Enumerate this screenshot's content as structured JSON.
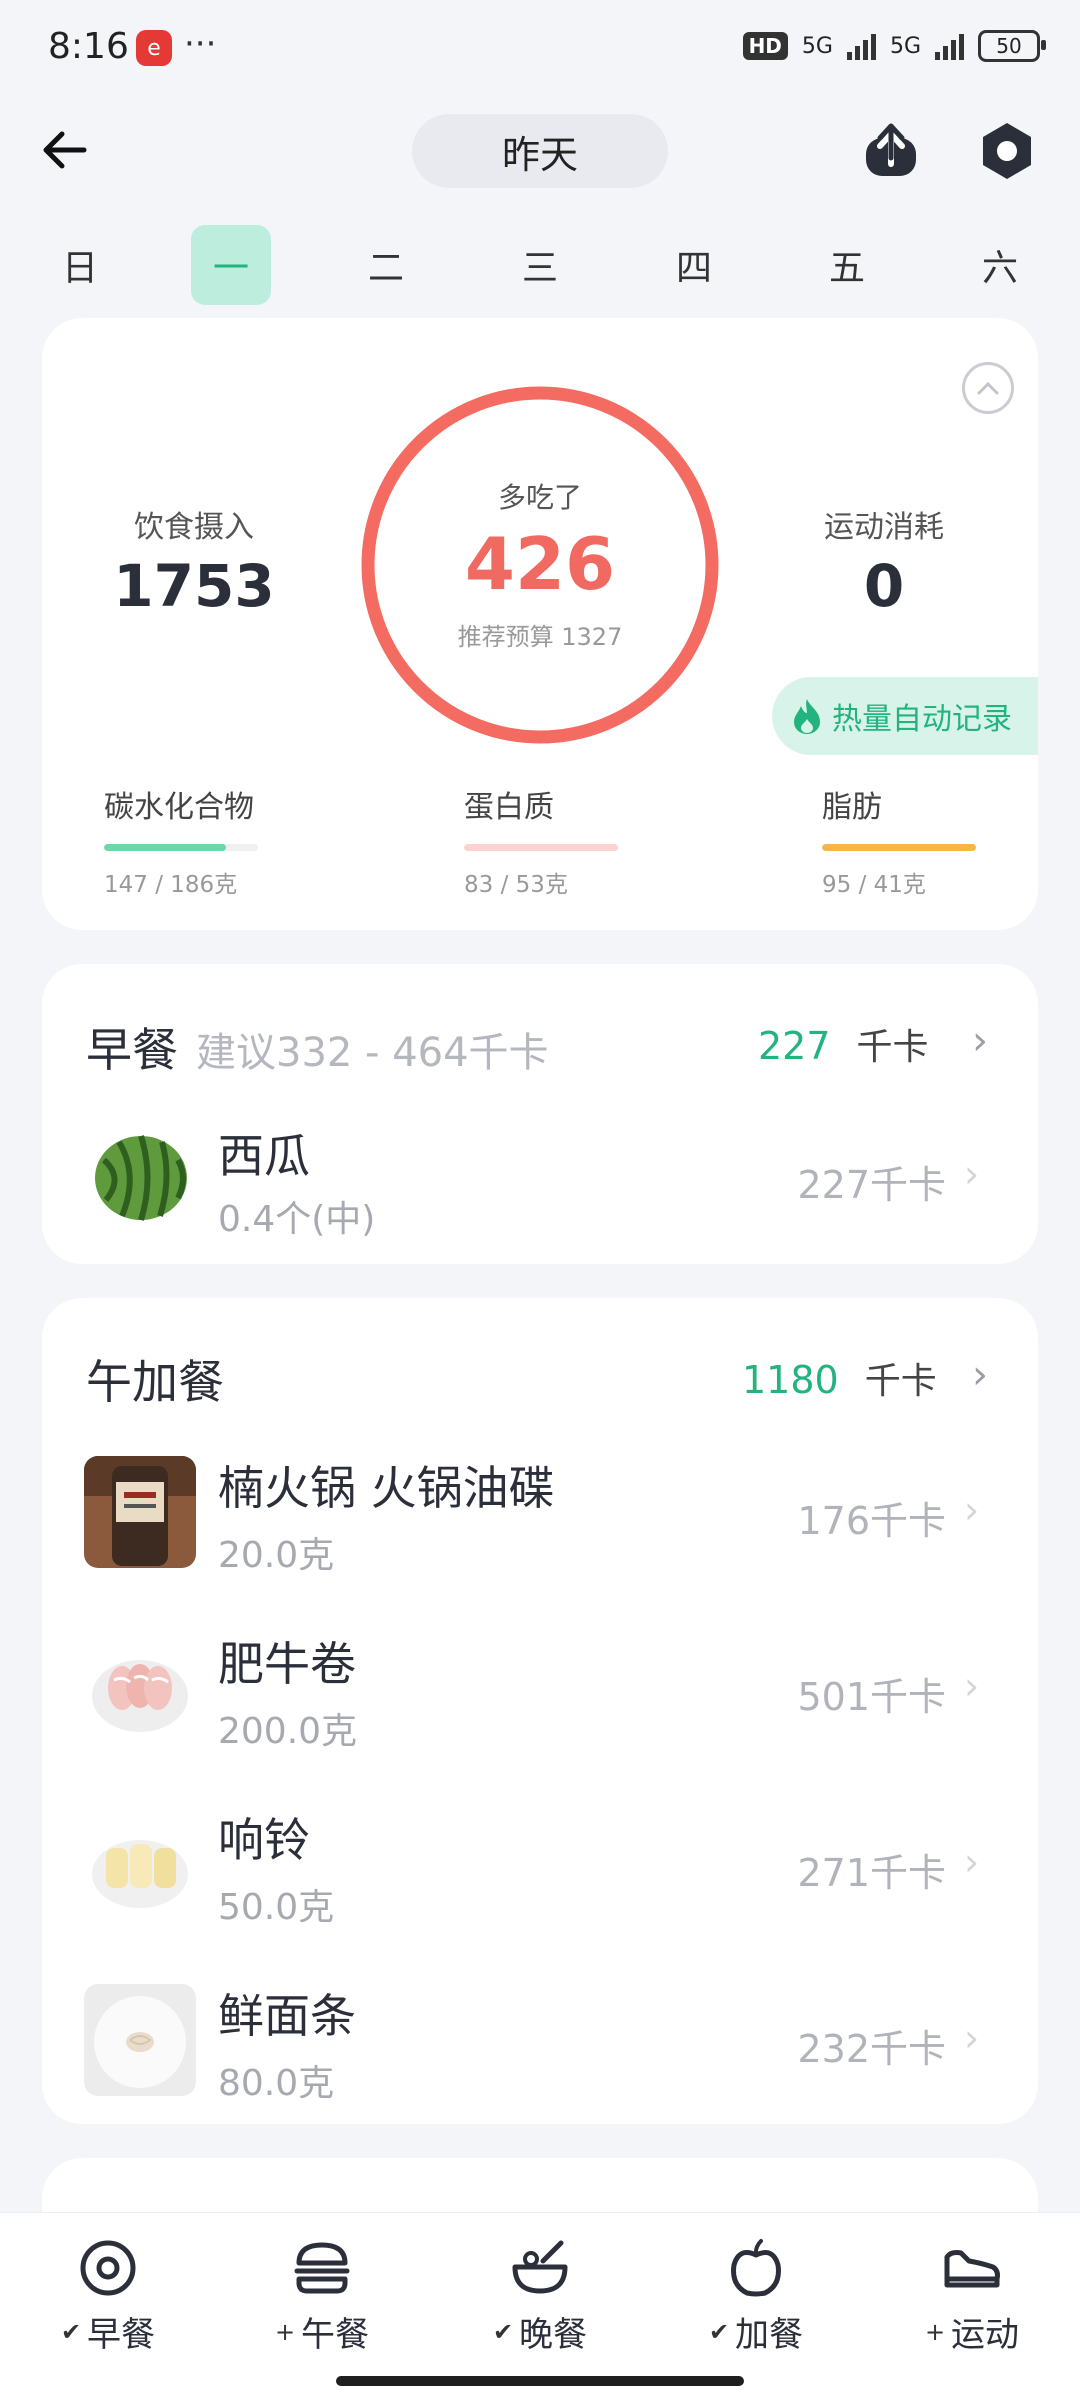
{
  "status_bar": {
    "time": "8:16",
    "app_badge": "e",
    "dots": "···",
    "hd": "HD",
    "net1": "5G",
    "net2": "5G",
    "battery": "50"
  },
  "header": {
    "date": "昨天"
  },
  "week": [
    "日",
    "一",
    "二",
    "三",
    "四",
    "五",
    "六"
  ],
  "selected_day_index": 1,
  "summary": {
    "intake_label": "饮食摄入",
    "intake_value": "1753",
    "ring_label": "多吃了",
    "ring_value": "426",
    "ring_sub": "推荐预算 1327",
    "burn_label": "运动消耗",
    "burn_value": "0",
    "auto_record": "热量自动记录",
    "macros": [
      {
        "name": "碳水化合物",
        "value": "147 / 186克",
        "fraction": 0.79,
        "color": "#6fd6a8"
      },
      {
        "name": "蛋白质",
        "value": "83 / 53克",
        "fraction": 1.0,
        "color": "#fbd3d0"
      },
      {
        "name": "脂肪",
        "value": "95 / 41克",
        "fraction": 1.0,
        "color": "#f7b548"
      }
    ],
    "ring_color": "#f46b61"
  },
  "breakfast": {
    "title": "早餐",
    "hint": "建议332 - 464千卡",
    "kcal": "227",
    "unit": "千卡",
    "items": [
      {
        "name": "西瓜",
        "amount": "0.4个(中)",
        "kcal": "227千卡"
      }
    ]
  },
  "lunch_snack": {
    "title": "午加餐",
    "kcal": "1180",
    "unit": "千卡",
    "items": [
      {
        "name": "楠火锅 火锅油碟",
        "amount": "20.0克",
        "kcal": "176千卡"
      },
      {
        "name": "肥牛卷",
        "amount": "200.0克",
        "kcal": "501千卡"
      },
      {
        "name": "响铃",
        "amount": "50.0克",
        "kcal": "271千卡"
      },
      {
        "name": "鲜面条",
        "amount": "80.0克",
        "kcal": "232千卡"
      }
    ]
  },
  "nav": [
    {
      "label": "早餐",
      "prefix": "✔",
      "icon": "breakfast-icon"
    },
    {
      "label": "午餐",
      "prefix": "+",
      "icon": "burger-icon"
    },
    {
      "label": "晚餐",
      "prefix": "✔",
      "icon": "bowl-icon"
    },
    {
      "label": "加餐",
      "prefix": "✔",
      "icon": "apple-icon"
    },
    {
      "label": "运动",
      "prefix": "+",
      "icon": "shoe-icon"
    }
  ],
  "accent_color": "#23b37e"
}
